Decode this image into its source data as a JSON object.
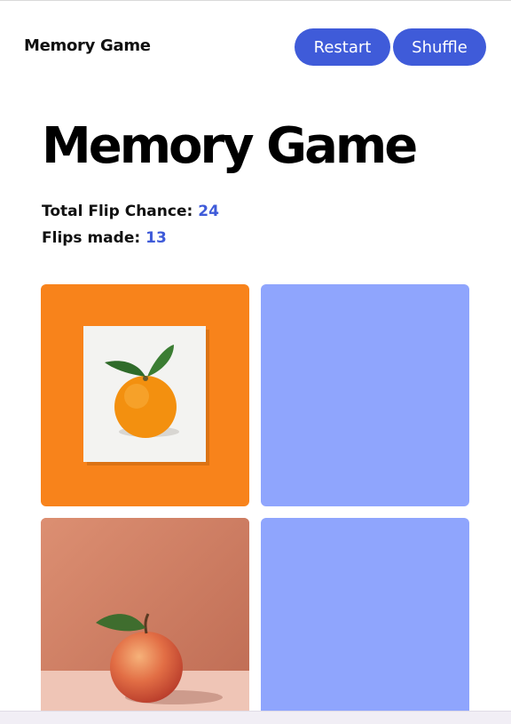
{
  "nav": {
    "brand": "Memory Game",
    "restart_label": "Restart",
    "shuffle_label": "Shuffle"
  },
  "main": {
    "title": "Memory Game",
    "stats": {
      "total_label": "Total Flip Chance:",
      "total_value": "24",
      "flips_label": "Flips made:",
      "flips_value": "13"
    },
    "cards": [
      {
        "state": "revealed",
        "image": "orange-on-white-card",
        "background": "#f8831b"
      },
      {
        "state": "hidden",
        "background": "#8fa5fd"
      },
      {
        "state": "revealed",
        "image": "apple-on-peach-backdrop",
        "background": "#d6876a"
      },
      {
        "state": "hidden",
        "background": "#8fa5fd"
      }
    ]
  },
  "colors": {
    "accent": "#3f5bd9",
    "card_back": "#8fa5fd",
    "orange_card": "#f8831b"
  }
}
